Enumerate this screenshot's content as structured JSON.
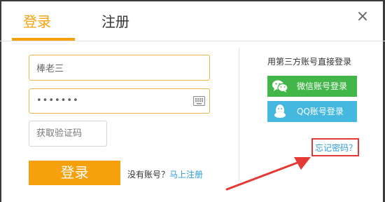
{
  "tabs": {
    "login": "登录",
    "register": "注册"
  },
  "close_icon": "×",
  "form": {
    "username_value": "棒老三",
    "password_value": "•••••••",
    "captcha_placeholder": "获取验证码",
    "login_button": "登录",
    "no_account_text": "没有账号？",
    "register_link": "马上注册"
  },
  "third_party": {
    "title": "用第三方账号直接登录",
    "wechat_label": "微信账号登录",
    "qq_label": "QQ账号登录"
  },
  "forgot_password": "忘记密码？",
  "colors": {
    "accent": "#f6a10b",
    "wechat": "#43b649",
    "qq": "#45b8df",
    "link": "#2c9cd6",
    "annotation": "#e53935"
  }
}
